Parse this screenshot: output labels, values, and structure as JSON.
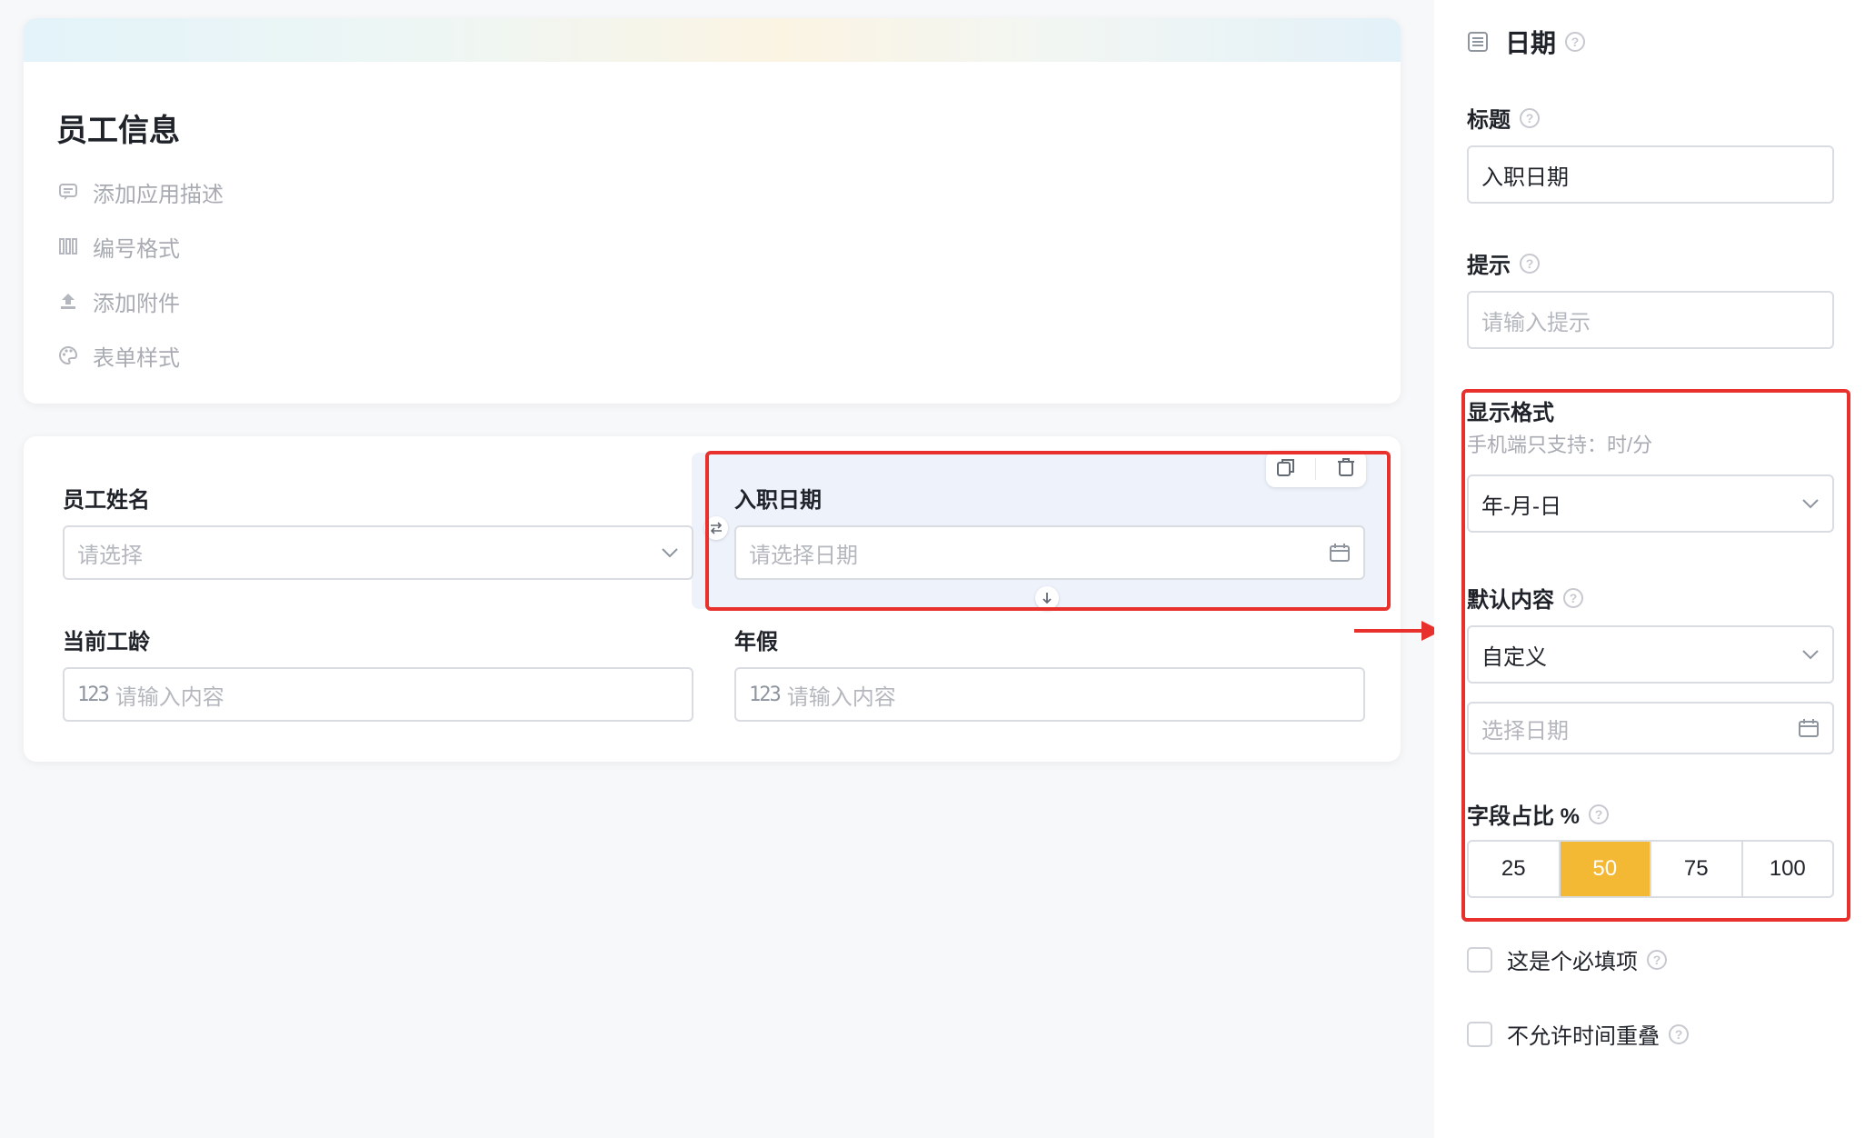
{
  "app_info": {
    "title": "员工信息",
    "actions": [
      {
        "label": "添加应用描述",
        "icon": "comment-icon"
      },
      {
        "label": "编号格式",
        "icon": "number-format-icon"
      },
      {
        "label": "添加附件",
        "icon": "upload-icon"
      },
      {
        "label": "表单样式",
        "icon": "palette-icon"
      }
    ]
  },
  "form": {
    "fields": [
      {
        "label": "员工姓名",
        "placeholder": "请选择",
        "type": "select"
      },
      {
        "label": "入职日期",
        "placeholder": "请选择日期",
        "type": "date",
        "selected": true
      },
      {
        "label": "当前工龄",
        "placeholder": "请输入内容",
        "type": "number"
      },
      {
        "label": "年假",
        "placeholder": "请输入内容",
        "type": "number"
      }
    ],
    "number_prefix": "123"
  },
  "panel": {
    "header": "日期",
    "title_label": "标题",
    "title_value": "入职日期",
    "hint_label": "提示",
    "hint_placeholder": "请输入提示",
    "format_label": "显示格式",
    "format_note": "手机端只支持：时/分",
    "format_value": "年-月-日",
    "default_label": "默认内容",
    "default_value": "自定义",
    "date_placeholder": "选择日期",
    "width_label": "字段占比 %",
    "width_options": [
      "25",
      "50",
      "75",
      "100"
    ],
    "width_selected": "50",
    "required_label": "这是个必填项",
    "no_overlap_label": "不允许时间重叠",
    "help_glyph": "?"
  },
  "colors": {
    "accent": "#f3b935",
    "annotation": "#e8302c",
    "selected_bg": "#eef2fb"
  }
}
